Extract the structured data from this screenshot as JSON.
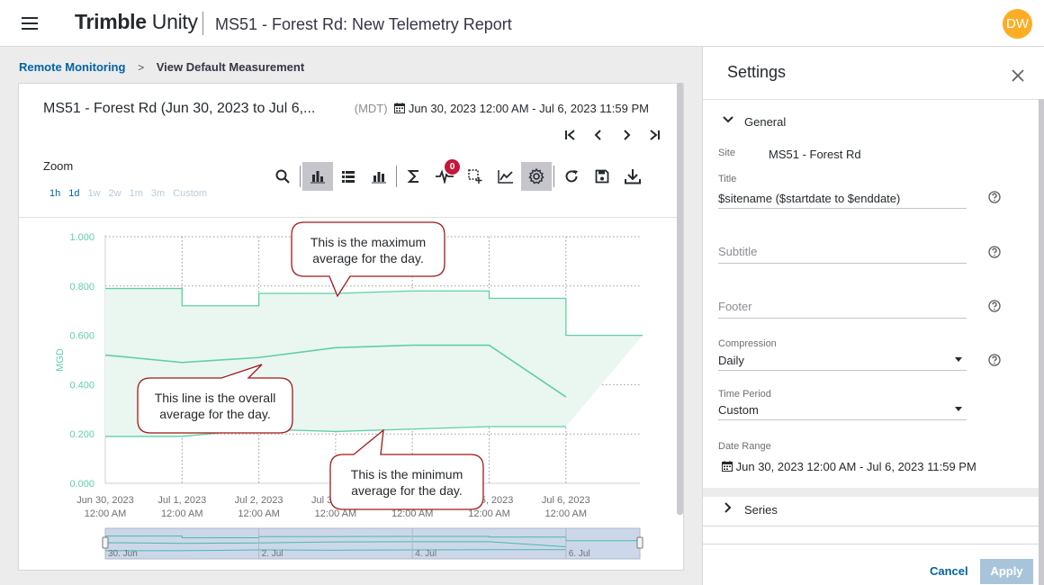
{
  "header": {
    "brand_bold": "Trimble",
    "brand_light": " Unity",
    "title": "MS51 - Forest Rd: New Telemetry Report",
    "avatar_initials": "DW"
  },
  "breadcrumb": {
    "link": "Remote Monitoring",
    "separator": ">",
    "current": "View Default Measurement"
  },
  "report": {
    "title": "MS51 - Forest Rd (Jun 30, 2023 to Jul 6,...",
    "timezone": "(MDT)",
    "date_range": "Jun 30, 2023 12:00 AM - Jul 6, 2023 11:59 PM",
    "zoom_label": "Zoom",
    "zoom_options": [
      "1h",
      "1d",
      "1w",
      "2w",
      "1m",
      "3m",
      "Custom"
    ],
    "zoom_active": [
      "1h",
      "1d"
    ],
    "alert_count": "0"
  },
  "toolbar_icons": [
    "search-icon",
    "bar-chart-icon",
    "list-icon",
    "stacked-bar-icon",
    "sigma-icon",
    "pulse-icon",
    "select-area-icon",
    "line-chart-icon",
    "gear-icon",
    "refresh-icon",
    "save-icon",
    "download-icon"
  ],
  "chart_data": {
    "type": "line",
    "ylabel": "MGD",
    "ylim": [
      0,
      1.0
    ],
    "y_ticks": [
      "1.000",
      "0.800",
      "0.600",
      "0.400",
      "0.200",
      "0.000"
    ],
    "x_ticks": [
      {
        "date": "Jun 30, 2023",
        "time": "12:00 AM"
      },
      {
        "date": "Jul 1, 2023",
        "time": "12:00 AM"
      },
      {
        "date": "Jul 2, 2023",
        "time": "12:00 AM"
      },
      {
        "date": "Jul 3, 2023",
        "time": "12:00 AM"
      },
      {
        "date": "Jul 4, 2023",
        "time": "12:00 AM"
      },
      {
        "date": "Jul 5, 2023",
        "time": "12:00 AM"
      },
      {
        "date": "Jul 6, 2023",
        "time": "12:00 AM"
      }
    ],
    "series": [
      {
        "x": [
          0,
          1,
          1,
          2,
          2,
          3,
          4,
          4,
          5,
          5,
          6,
          6,
          7
        ],
        "values": [
          0.79,
          0.79,
          0.72,
          0.72,
          0.77,
          0.77,
          0.78,
          0.78,
          0.78,
          0.75,
          0.75,
          0.6,
          0.6
        ]
      },
      {
        "x": [
          0,
          1,
          2,
          3,
          4,
          5,
          6
        ],
        "values": [
          0.52,
          0.49,
          0.51,
          0.55,
          0.56,
          0.56,
          0.35
        ]
      },
      {
        "x": [
          0,
          1,
          2,
          3,
          4,
          5,
          6
        ],
        "values": [
          0.19,
          0.19,
          0.22,
          0.21,
          0.22,
          0.23,
          0.23
        ]
      }
    ],
    "navigator_labels": [
      "30. Jun",
      "2. Jul",
      "4. Jul",
      "6. Jul"
    ],
    "line_color": "#5fcfa5",
    "band_color": "#eaf7f1",
    "grid": true
  },
  "callouts": {
    "max": [
      "This is the maximum",
      "average for the day."
    ],
    "avg": [
      "This line is the overall",
      "average for the day."
    ],
    "min": [
      "This is the minimum",
      "average for the day."
    ]
  },
  "settings": {
    "title": "Settings",
    "general_label": "General",
    "site_label": "Site",
    "site_value": "MS51 - Forest Rd",
    "title_label": "Title",
    "title_value": "$sitename ($startdate to $enddate)",
    "subtitle_placeholder": "Subtitle",
    "footer_placeholder": "Footer",
    "compression_label": "Compression",
    "compression_value": "Daily",
    "time_period_label": "Time Period",
    "time_period_value": "Custom",
    "date_range_label": "Date Range",
    "date_range_value": "Jun 30, 2023 12:00 AM - Jul 6, 2023 11:59 PM",
    "series_label": "Series",
    "cancel_label": "Cancel",
    "apply_label": "Apply"
  },
  "colors": {
    "brand_blue": "#0063a3",
    "avatar": "#fbad26",
    "callout_border": "#a01818",
    "badge": "#c5163b"
  }
}
